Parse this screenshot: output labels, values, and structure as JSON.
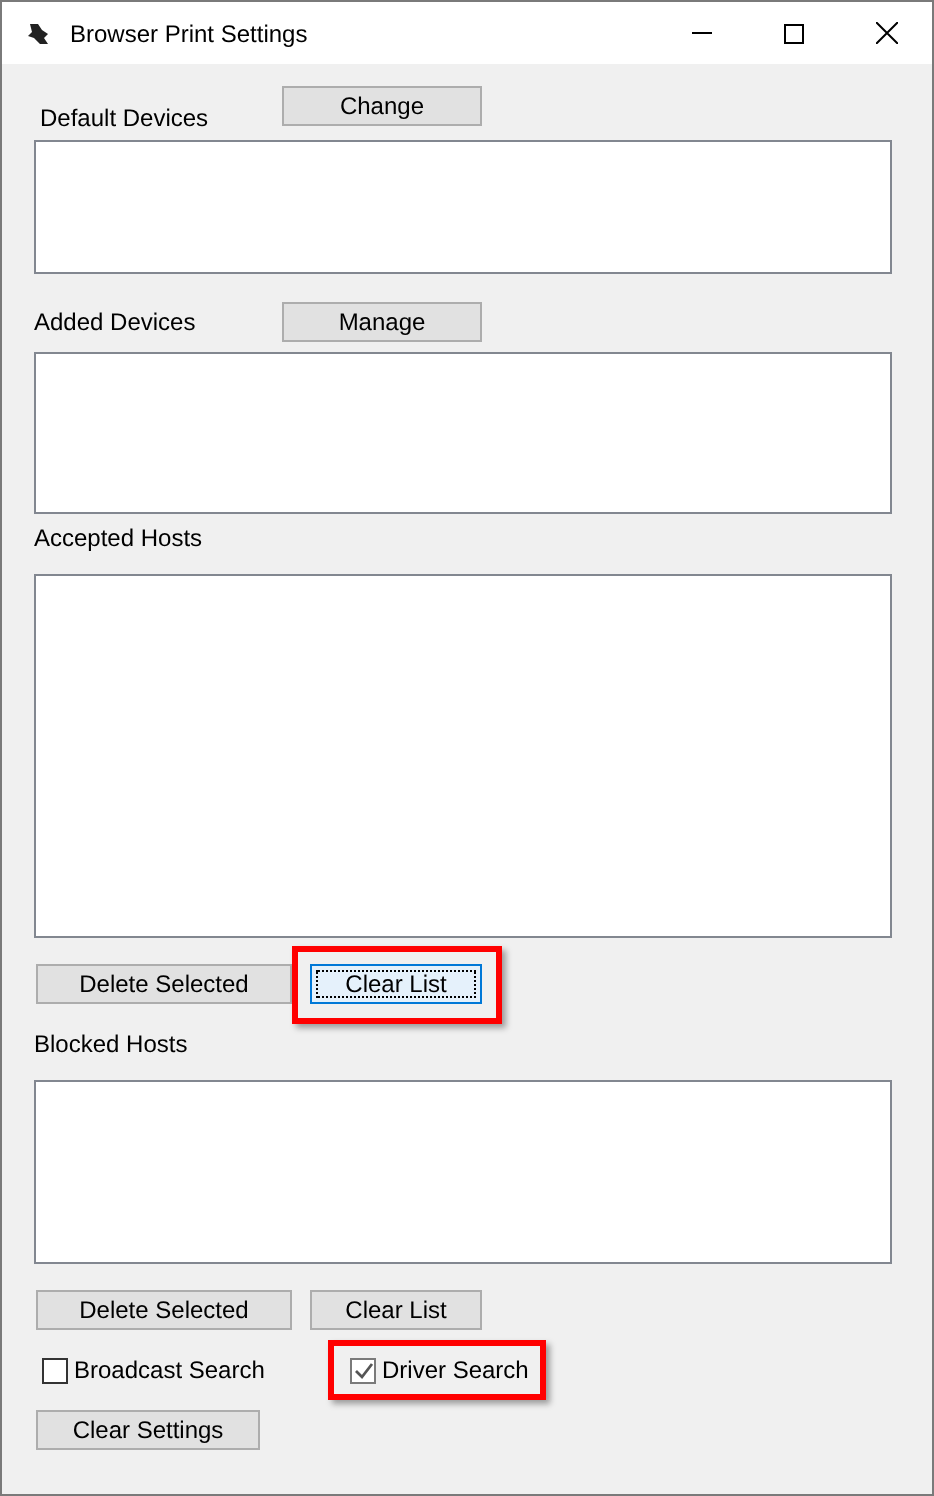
{
  "window": {
    "title": "Browser Print Settings"
  },
  "sections": [
    {
      "label": "Default Devices",
      "button": {
        "label": "Change"
      }
    },
    {
      "label": "Added Devices",
      "button": {
        "label": "Manage"
      }
    },
    {
      "label": "Accepted Hosts",
      "actions": [
        {
          "label": "Delete Selected",
          "focused": false,
          "highlighted": false
        },
        {
          "label": "Clear List",
          "focused": true,
          "highlighted": true
        }
      ]
    },
    {
      "label": "Blocked Hosts",
      "actions": [
        {
          "label": "Delete Selected",
          "focused": false,
          "highlighted": false
        },
        {
          "label": "Clear List",
          "focused": false,
          "highlighted": false
        }
      ]
    }
  ],
  "options": [
    {
      "label": "Broadcast Search",
      "checked": false,
      "highlighted": false
    },
    {
      "label": "Driver Search",
      "checked": true,
      "highlighted": true
    }
  ],
  "footer_button": {
    "label": "Clear Settings"
  }
}
